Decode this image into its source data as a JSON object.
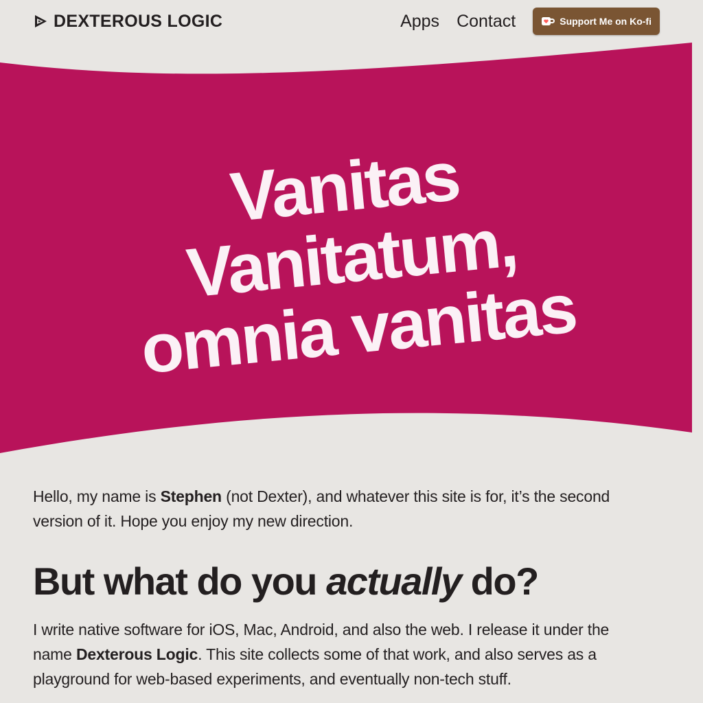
{
  "header": {
    "brand": "DEXTEROUS LOGIC",
    "nav": [
      "Apps",
      "Contact"
    ],
    "kofi_label": "Support Me on Ko-fi",
    "kofi_icon": "ko-fi-cup-icon",
    "logo_icon": "dexterous-logic-logo-icon"
  },
  "hero": {
    "lines": [
      "Vanitas",
      "Vanitatum,",
      "omnia vanitas"
    ],
    "band_color": "#b8135a",
    "text_color": "#fbf1f6"
  },
  "intro": {
    "p1": "Hello, my name is ",
    "name": "Stephen",
    "p2": " (not Dexter), and whatever this site is for, it’s the second version of it. Hope you enjoy my new direction."
  },
  "section": {
    "h_pre": "But what do you ",
    "h_em": "actually",
    "h_post": " do?",
    "p1": "I write native software for iOS, Mac, Android, and also the web. I release it under the name ",
    "brand": "Dexterous Logic",
    "p2": ". This site collects some of that work, and also serves as a playground for web-based experiments, and eventually non-tech stuff."
  },
  "colors": {
    "background": "#e8e6e3",
    "text": "#231f20",
    "kofi_button": "#7a5533"
  }
}
